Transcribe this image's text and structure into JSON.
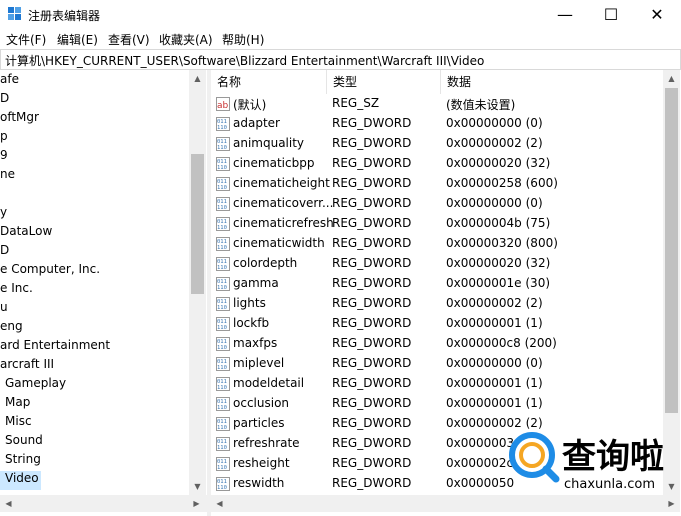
{
  "window": {
    "title": "注册表编辑器",
    "minimize": "—",
    "maximize": "☐",
    "close": "✕"
  },
  "menu": [
    "文件(F)",
    "编辑(E)",
    "查看(V)",
    "收藏夹(A)",
    "帮助(H)"
  ],
  "address": "计算机\\HKEY_CURRENT_USER\\Software\\Blizzard Entertainment\\Warcraft III\\Video",
  "tree": {
    "items": [
      "afe",
      "D",
      "oftMgr",
      "p",
      "9",
      "ne",
      "",
      "y",
      "DataLow",
      "D",
      "e Computer, Inc.",
      "e Inc.",
      "u",
      "eng",
      "ard Entertainment",
      "arcraft III",
      "Gameplay",
      "Map",
      "Misc",
      "Sound",
      "String",
      "Video"
    ],
    "selected_index": 21
  },
  "columns": {
    "name": "名称",
    "type": "类型",
    "data": "数据"
  },
  "rows": [
    {
      "icon": "string-value-icon",
      "name": "(默认)",
      "type": "REG_SZ",
      "data": "(数值未设置)"
    },
    {
      "icon": "dword-value-icon",
      "name": "adapter",
      "type": "REG_DWORD",
      "data": "0x00000000 (0)"
    },
    {
      "icon": "dword-value-icon",
      "name": "animquality",
      "type": "REG_DWORD",
      "data": "0x00000002 (2)"
    },
    {
      "icon": "dword-value-icon",
      "name": "cinematicbpp",
      "type": "REG_DWORD",
      "data": "0x00000020 (32)"
    },
    {
      "icon": "dword-value-icon",
      "name": "cinematicheight",
      "type": "REG_DWORD",
      "data": "0x00000258 (600)"
    },
    {
      "icon": "dword-value-icon",
      "name": "cinematicoverr...",
      "type": "REG_DWORD",
      "data": "0x00000000 (0)"
    },
    {
      "icon": "dword-value-icon",
      "name": "cinematicrefresh",
      "type": "REG_DWORD",
      "data": "0x0000004b (75)"
    },
    {
      "icon": "dword-value-icon",
      "name": "cinematicwidth",
      "type": "REG_DWORD",
      "data": "0x00000320 (800)"
    },
    {
      "icon": "dword-value-icon",
      "name": "colordepth",
      "type": "REG_DWORD",
      "data": "0x00000020 (32)"
    },
    {
      "icon": "dword-value-icon",
      "name": "gamma",
      "type": "REG_DWORD",
      "data": "0x0000001e (30)"
    },
    {
      "icon": "dword-value-icon",
      "name": "lights",
      "type": "REG_DWORD",
      "data": "0x00000002 (2)"
    },
    {
      "icon": "dword-value-icon",
      "name": "lockfb",
      "type": "REG_DWORD",
      "data": "0x00000001 (1)"
    },
    {
      "icon": "dword-value-icon",
      "name": "maxfps",
      "type": "REG_DWORD",
      "data": "0x000000c8 (200)"
    },
    {
      "icon": "dword-value-icon",
      "name": "miplevel",
      "type": "REG_DWORD",
      "data": "0x00000000 (0)"
    },
    {
      "icon": "dword-value-icon",
      "name": "modeldetail",
      "type": "REG_DWORD",
      "data": "0x00000001 (1)"
    },
    {
      "icon": "dword-value-icon",
      "name": "occlusion",
      "type": "REG_DWORD",
      "data": "0x00000001 (1)"
    },
    {
      "icon": "dword-value-icon",
      "name": "particles",
      "type": "REG_DWORD",
      "data": "0x00000002 (2)"
    },
    {
      "icon": "dword-value-icon",
      "name": "refreshrate",
      "type": "REG_DWORD",
      "data": "0x0000003"
    },
    {
      "icon": "dword-value-icon",
      "name": "resheight",
      "type": "REG_DWORD",
      "data": "0x000002c"
    },
    {
      "icon": "dword-value-icon",
      "name": "reswidth",
      "type": "REG_DWORD",
      "data": "0x0000050"
    }
  ],
  "watermark": {
    "title": "查询啦",
    "site": "chaxunla.com"
  },
  "colors": {
    "selected": "#cce8ff",
    "dword_icon": "#3c78b4",
    "string_icon": "#c83232",
    "brand_blue": "#1e8ce6"
  }
}
